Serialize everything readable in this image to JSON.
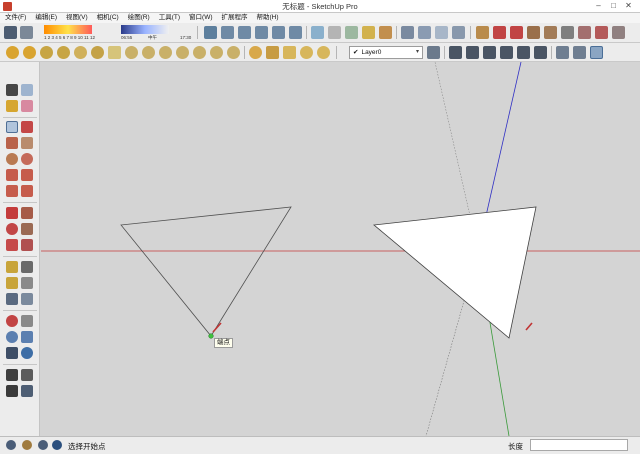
{
  "window": {
    "title": "无标题 - SketchUp Pro",
    "minimize_icon": "minimize-icon",
    "maximize_icon": "maximize-icon",
    "close_icon": "close-icon"
  },
  "menu": [
    "文件(F)",
    "编辑(E)",
    "视图(V)",
    "相机(C)",
    "绘图(R)",
    "工具(T)",
    "窗口(W)",
    "扩展程序",
    "帮助(H)"
  ],
  "toolbar_top": {
    "palette_numbers": "1 2 3 4 5 6 7 8 9 10 11 12",
    "time_start": "06:55",
    "time_mid": "中午",
    "time_end": "17:30"
  },
  "toolbar_second": {
    "layer_selected": "Layer0",
    "layer_check": "✔",
    "layer_dropdown_icon": "▾"
  },
  "viewport": {
    "tooltip": "端点",
    "axis_colors": {
      "red": "#c43a3a",
      "green": "#3a9a3a",
      "blue": "#3030c4"
    }
  },
  "status": {
    "hint": "选择开始点",
    "measure_label": "长度",
    "measure_value": ""
  }
}
